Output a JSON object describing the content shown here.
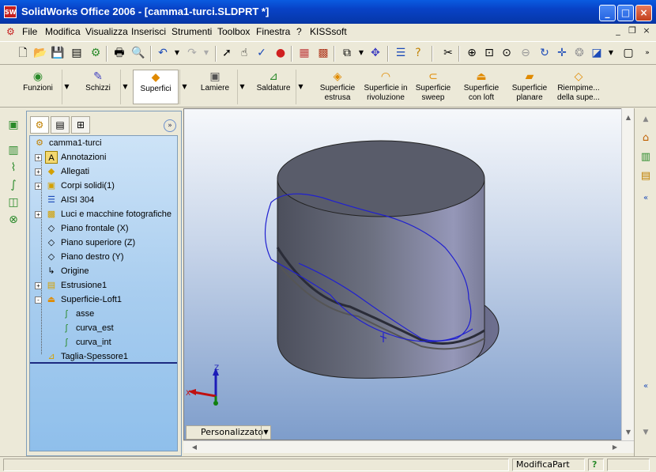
{
  "window": {
    "title": "SolidWorks Office 2006 - [camma1-turci.SLDPRT *]",
    "logo": "SW"
  },
  "menu": [
    "File",
    "Modifica",
    "Visualizza",
    "Inserisci",
    "Strumenti",
    "Toolbox",
    "Finestra",
    "?",
    "KISSsoft"
  ],
  "command_manager": {
    "groups": [
      {
        "label": "Funzioni",
        "icon": "feature-icon"
      },
      {
        "label": "Schizzi",
        "icon": "sketch-icon"
      },
      {
        "label": "Superfici",
        "icon": "surface-icon",
        "selected": true
      },
      {
        "label": "Lamiere",
        "icon": "sheetmetal-icon"
      },
      {
        "label": "Saldature",
        "icon": "weldment-icon"
      }
    ],
    "tools": [
      {
        "label": "Superficie estrusa"
      },
      {
        "label": "Superficie in rivoluzione"
      },
      {
        "label": "Superficie sweep"
      },
      {
        "label": "Superficie con loft"
      },
      {
        "label": "Superficie planare"
      },
      {
        "label": "Riempime... della supe..."
      }
    ]
  },
  "feature_tree": {
    "root": "camma1-turci",
    "nodes": [
      {
        "label": "Annotazioni",
        "icon": "annotations-icon",
        "expander": "+"
      },
      {
        "label": "Allegati",
        "icon": "attachments-icon",
        "expander": "+"
      },
      {
        "label": "Corpi solidi(1)",
        "icon": "solid-bodies-icon",
        "expander": "+"
      },
      {
        "label": "AISI 304",
        "icon": "material-icon",
        "expander": ""
      },
      {
        "label": "Luci e macchine fotografiche",
        "icon": "lights-icon",
        "expander": "+"
      },
      {
        "label": "Piano frontale (X)",
        "icon": "plane-icon",
        "expander": ""
      },
      {
        "label": "Piano superiore (Z)",
        "icon": "plane-icon",
        "expander": ""
      },
      {
        "label": "Piano destro (Y)",
        "icon": "plane-icon",
        "expander": ""
      },
      {
        "label": "Origine",
        "icon": "origin-icon",
        "expander": ""
      },
      {
        "label": "Estrusione1",
        "icon": "extrude-icon",
        "expander": "+"
      },
      {
        "label": "Superficie-Loft1",
        "icon": "loft-icon",
        "expander": "-"
      },
      {
        "label": "asse",
        "icon": "curve-icon",
        "expander": "",
        "child": true
      },
      {
        "label": "curva_est",
        "icon": "curve-icon",
        "expander": "",
        "child": true
      },
      {
        "label": "curva_int",
        "icon": "curve-icon",
        "expander": "",
        "child": true
      },
      {
        "label": "Taglia-Spessore1",
        "icon": "thicken-cut-icon",
        "expander": ""
      }
    ]
  },
  "viewport": {
    "tab_label": "Personalizzato",
    "triad": {
      "x": "X",
      "z": "Z"
    }
  },
  "status": {
    "mode": "ModificaPart",
    "help": "?"
  }
}
